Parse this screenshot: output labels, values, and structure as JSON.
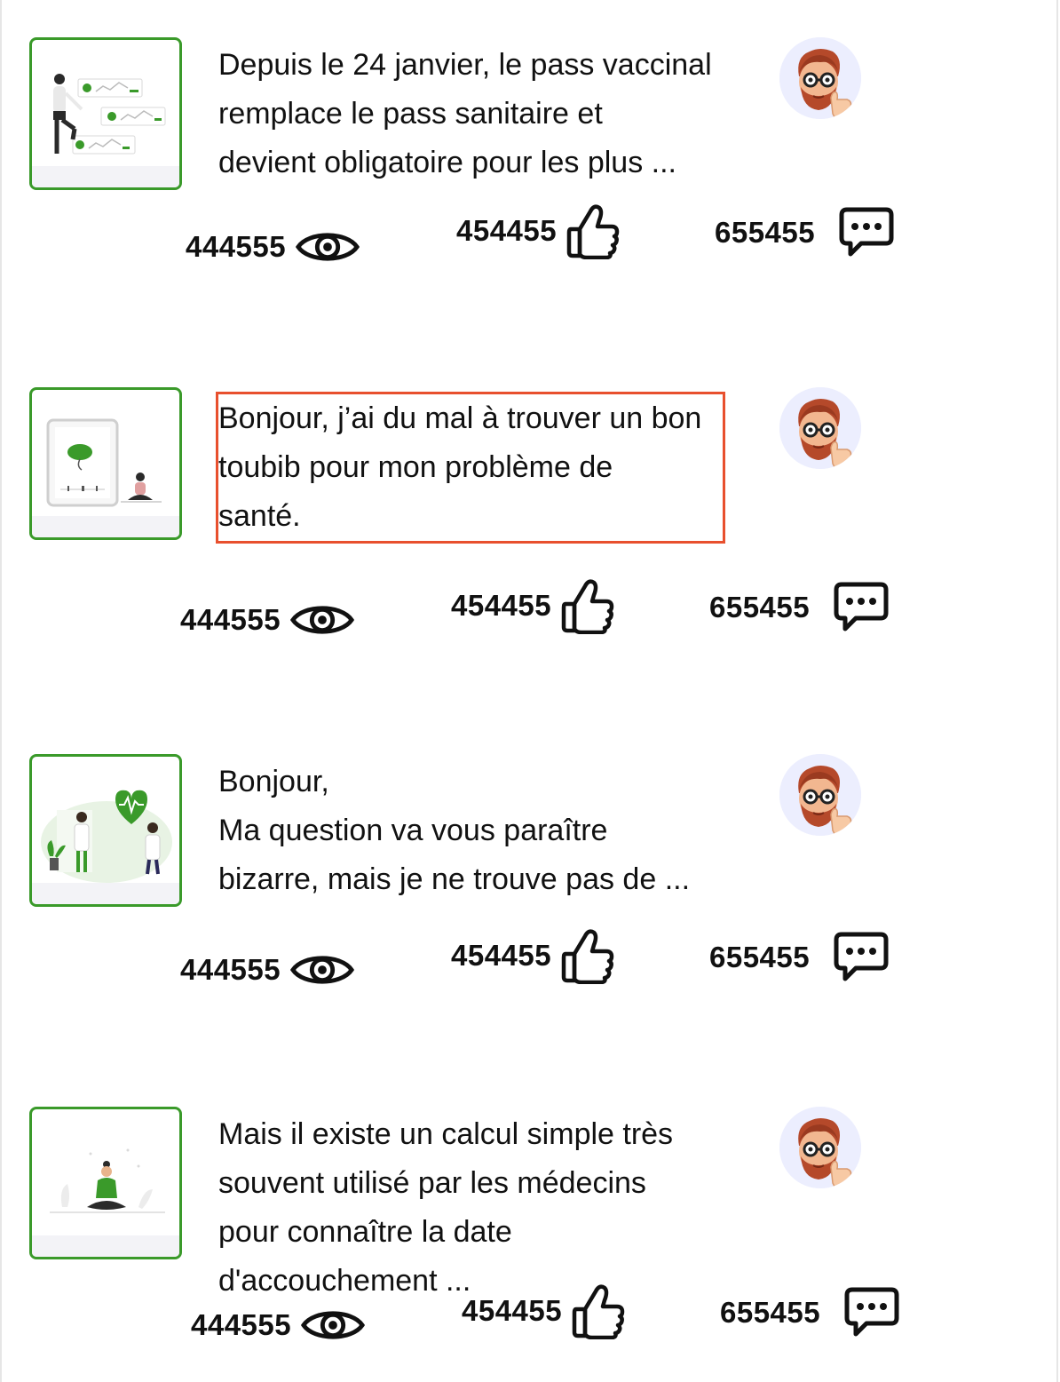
{
  "posts": [
    {
      "text": "Depuis le 24 janvier, le pass vaccinal\nremplace le pass sanitaire et\ndevient obligatoire pour les plus ...",
      "views": "444555",
      "likes": "454455",
      "comments": "655455"
    },
    {
      "text": "Bonjour, j’ai du mal à trouver un bon\ntoubib pour mon problème de\nsanté.",
      "views": "444555",
      "likes": "454455",
      "comments": "655455"
    },
    {
      "text": "Bonjour,\nMa question va vous paraître\nbizarre, mais je ne trouve pas de ...",
      "views": "444555",
      "likes": "454455",
      "comments": "655455"
    },
    {
      "text": "Mais il existe un calcul simple très\nsouvent utilisé par les médecins\npour connaître la date\nd'accouchement ...",
      "views": "444555",
      "likes": "454455",
      "comments": "655455"
    }
  ],
  "icons": {
    "views": "eye-icon",
    "likes": "thumbs-up-icon",
    "comments": "comment-bubble-icon"
  },
  "colors": {
    "thumb_border": "#3a9a2a",
    "highlight": "#e8502e",
    "avatar_bg": "#eceefe"
  }
}
